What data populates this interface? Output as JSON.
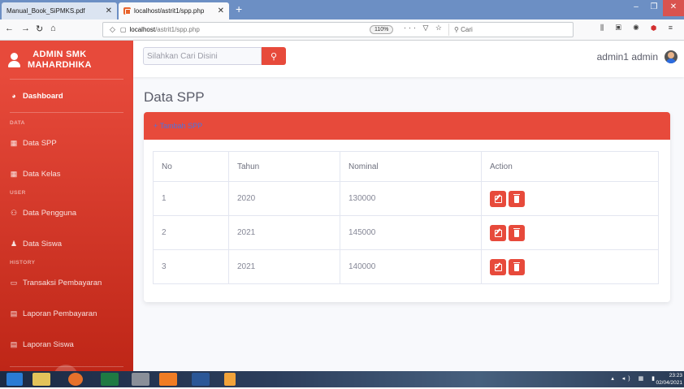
{
  "browser": {
    "tabs": [
      {
        "label": "Manual_Book_SiPMKS.pdf"
      },
      {
        "label": "localhost/astrit1/spp.php"
      }
    ],
    "url_host": "localhost",
    "url_path": "/astrit1/spp.php",
    "zoom": "110%",
    "search_placeholder": "Cari"
  },
  "sidebar": {
    "brand_line1": "ADMIN SMK",
    "brand_line2": "MAHARDHIKA",
    "dashboard": "Dashboard",
    "sections": {
      "data": "DATA",
      "user": "USER",
      "history": "HISTORY"
    },
    "items": {
      "data_spp": "Data SPP",
      "data_kelas": "Data Kelas",
      "data_pengguna": "Data Pengguna",
      "data_siswa": "Data Siswa",
      "transaksi": "Transaksi Pembayaran",
      "laporan_pembayaran": "Laporan Pembayaran",
      "laporan_siswa": "Laporan Siswa"
    }
  },
  "topbar": {
    "search_placeholder": "Silahkan Cari Disini",
    "user_name": "admin1 admin"
  },
  "main": {
    "title": "Data SPP",
    "add_link": "+ Tambah SPP",
    "table": {
      "headers": [
        "No",
        "Tahun",
        "Nominal",
        "Action"
      ],
      "rows": [
        [
          "1",
          "2020",
          "130000"
        ],
        [
          "2",
          "2021",
          "145000"
        ],
        [
          "3",
          "2021",
          "140000"
        ]
      ]
    }
  },
  "taskbar": {
    "time": "23:23",
    "date": "02/04/2021"
  },
  "colors": {
    "accent": "#e74a3b",
    "link": "#4e73df"
  }
}
